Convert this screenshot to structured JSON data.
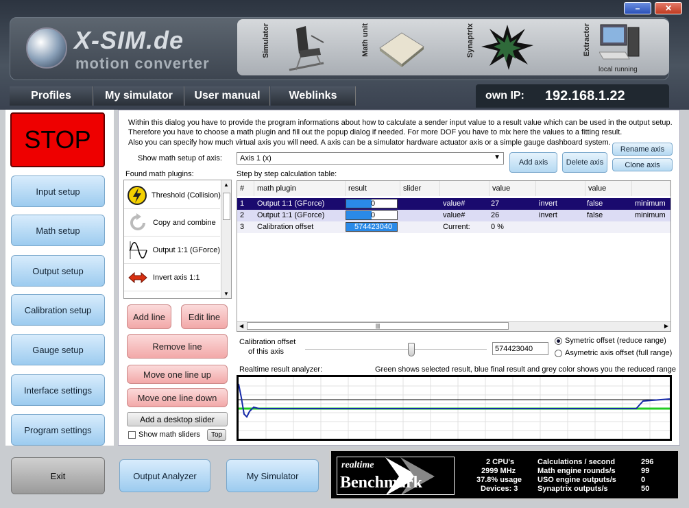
{
  "window": {
    "minimize_label": "–",
    "close_label": "✕"
  },
  "logo": {
    "title": "X-SIM.de",
    "subtitle": "motion converter"
  },
  "modules": [
    {
      "label": "Simulator"
    },
    {
      "label": "Math unit"
    },
    {
      "label": "Synaptrix"
    },
    {
      "label": "Extractor",
      "status": "local running"
    }
  ],
  "nav": {
    "tabs": [
      "Profiles",
      "My simulator",
      "User manual",
      "Weblinks"
    ]
  },
  "ip": {
    "label": "own IP:",
    "value": "192.168.1.22"
  },
  "sidebar": {
    "stop_label": "STOP",
    "items": [
      "Input setup",
      "Math setup",
      "Output setup",
      "Calibration setup",
      "Gauge setup",
      "Interface settings",
      "Program settings"
    ],
    "exit_label": "Exit"
  },
  "bottom": {
    "output_analyzer": "Output Analyzer",
    "my_simulator": "My Simulator"
  },
  "intro": [
    "Within this dialog you have to provide the program informations about how to calculate a sender input value to a result value which can be used in the output setup.",
    "Therefore you have to choose a math plugin and fill out the popup dialog if needed. For more DOF you have to mix here the values to a fitting result.",
    "Also you can specify how much virtual axis you will need. A axis can be a simulator hardware actuator axis or a simple gauge dashboard system."
  ],
  "axis_select": {
    "label": "Show math setup of axis:",
    "value": "Axis 1 (x)"
  },
  "axis_buttons": {
    "add": "Add axis",
    "delete": "Delete axis",
    "rename": "Rename axis",
    "clone": "Clone axis"
  },
  "plugins": {
    "label": "Found math plugins:",
    "items": [
      {
        "name": "Threshold (Collision)",
        "icon": "lightning-icon"
      },
      {
        "name": "Copy and combine",
        "icon": "refresh-icon"
      },
      {
        "name": "Output 1:1 (GForce)",
        "icon": "sine-wave-icon"
      },
      {
        "name": "Invert axis 1:1",
        "icon": "invert-arrows-icon"
      }
    ]
  },
  "edit_buttons": {
    "add_line": "Add line",
    "edit_line": "Edit line",
    "remove_line": "Remove line",
    "move_up": "Move one line up",
    "move_down": "Move one line down",
    "add_slider": "Add a desktop slider"
  },
  "show_sliders": {
    "label": "Show math sliders",
    "top_button": "Top"
  },
  "table": {
    "label": "Step by step calculation table:",
    "headers": [
      "#",
      "math plugin",
      "result",
      "slider",
      "",
      "value",
      "",
      "value",
      ""
    ],
    "rows": [
      {
        "num": "1",
        "plugin": "Output 1:1 (GForce)",
        "result": "0",
        "result_fill": 0.5,
        "c4": "value#",
        "c5": "27",
        "c6": "invert",
        "c7": "false",
        "c8": "minimum"
      },
      {
        "num": "2",
        "plugin": "Output 1:1 (GForce)",
        "result": "0",
        "result_fill": 0.5,
        "c4": "value#",
        "c5": "26",
        "c6": "invert",
        "c7": "false",
        "c8": "minimum"
      },
      {
        "num": "3",
        "plugin": "Calibration offset",
        "result": "574423040",
        "result_fill": 1.0,
        "c4": "Current:",
        "c5": "0 %",
        "c6": "",
        "c7": "",
        "c8": ""
      }
    ],
    "scroll_thumb": "|||"
  },
  "calibration": {
    "label_line1": "Calibration offset",
    "label_line2": "of this axis",
    "value": "574423040",
    "slider_position": 0.59,
    "radio1": "Symetric offset (reduce range)",
    "radio2": "Asymetric axis offset (full range)"
  },
  "analyzer": {
    "label": "Realtime result analyzer:",
    "legend": "Green shows selected result, blue final result and grey color shows you the reduced range"
  },
  "benchmark": {
    "logo_line1": "realtime",
    "logo_line2": "Benchmark",
    "stats_left": [
      "2 CPU's",
      "2999 MHz",
      "37.8% usage",
      "Devices: 3"
    ],
    "stats_labels": [
      "Calculations / second",
      "Math engine rounds/s",
      "USO engine outputs/s",
      "Synaptrix outputs/s"
    ],
    "stats_values": [
      "296",
      "99",
      "0",
      "50"
    ]
  },
  "colors": {
    "stop": "#ee0000",
    "selected_row": "#1a0a6e",
    "result_bar": "#2a8ae8",
    "green_line": "#22cc22",
    "blue_line": "#1428a8"
  }
}
